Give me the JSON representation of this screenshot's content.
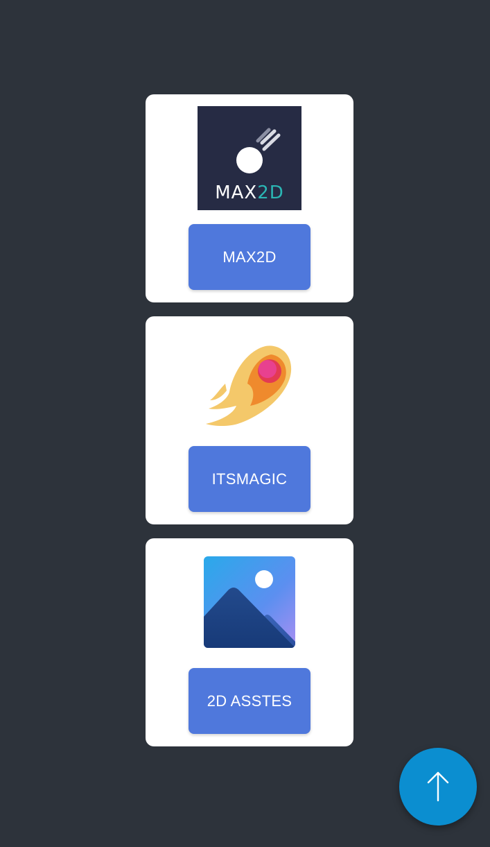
{
  "cards": [
    {
      "logo_icon": "max2d-logo-icon",
      "logo_text_part1": "MAX",
      "logo_text_part2": "2D",
      "button_label": "MAX2D"
    },
    {
      "logo_icon": "fireball-comet-icon",
      "button_label": "ITSMAGIC"
    },
    {
      "logo_icon": "image-mountain-icon",
      "button_label": "2D ASSTES"
    }
  ],
  "fab": {
    "icon": "arrow-up-icon"
  },
  "colors": {
    "background": "#2d333b",
    "card": "#ffffff",
    "button": "#4f78dc",
    "fab": "#0b8ed0",
    "max2d_logo_bg": "#262b44",
    "max2d_accent": "#2bb6b4"
  }
}
